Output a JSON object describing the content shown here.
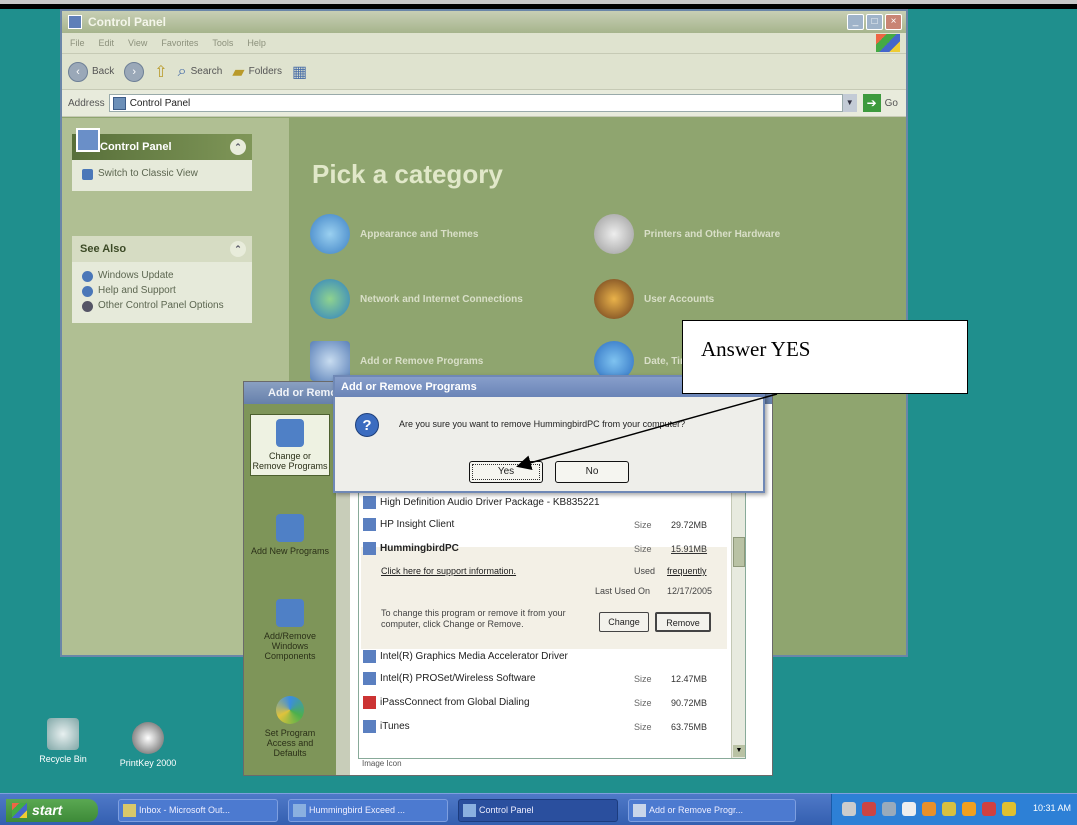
{
  "cp": {
    "title": "Control Panel",
    "menu": [
      "File",
      "Edit",
      "View",
      "Favorites",
      "Tools",
      "Help"
    ],
    "back_label": "Back",
    "search_label": "Search",
    "folders_label": "Folders",
    "address_label": "Address",
    "address_value": "Control Panel",
    "go_label": "Go",
    "panel_title": "Control Panel",
    "switch_view": "Switch to Classic View",
    "see_also_title": "See Also",
    "see_also": [
      "Windows Update",
      "Help and Support",
      "Other Control Panel Options"
    ],
    "pick_heading": "Pick a category",
    "categories": [
      "Appearance and Themes",
      "Printers and Other Hardware",
      "Network and Internet Connections",
      "User Accounts",
      "Add or Remove Programs",
      "Date, Time, Language, and Regional Options"
    ]
  },
  "arp": {
    "title": "Add or Remove Programs",
    "side": [
      "Change or Remove Programs",
      "Add New Programs",
      "Add/Remove Windows Components",
      "Set Program Access and Defaults"
    ],
    "programs": [
      {
        "name": "High Definition Audio Driver Package - KB835221",
        "size": ""
      },
      {
        "name": "HP Insight Client",
        "size": "29.72MB"
      },
      {
        "name": "HummingbirdPC",
        "size": "15.91MB"
      },
      {
        "name": "Intel(R) Graphics Media Accelerator Driver",
        "size": ""
      },
      {
        "name": "Intel(R) PROSet/Wireless Software",
        "size": "12.47MB"
      },
      {
        "name": "iPassConnect from Global Dialing",
        "size": "90.72MB"
      },
      {
        "name": "iTunes",
        "size": "63.75MB"
      }
    ],
    "size_label": "Size",
    "support_link": "Click here for support information.",
    "used_label": "Used",
    "used_value": "frequently",
    "last_used_label": "Last Used On",
    "last_used_value": "12/17/2005",
    "change_text": "To change this program or remove it from your computer, click Change or Remove.",
    "change_btn": "Change",
    "remove_btn": "Remove",
    "footer": "Image Icon"
  },
  "dialog": {
    "title": "Add or Remove Programs",
    "message": "Are you sure you want to remove HummingbirdPC from your computer?",
    "yes": "Yes",
    "no": "No"
  },
  "callout": {
    "text": "Answer YES"
  },
  "desktop": {
    "recycle": "Recycle Bin",
    "printkey": "PrintKey 2000"
  },
  "taskbar": {
    "start": "start",
    "tasks": [
      "Inbox - Microsoft Out...",
      "Hummingbird Exceed ...",
      "Control Panel",
      "Add or Remove Progr..."
    ],
    "clock": "10:31 AM"
  },
  "colors": {
    "desktop": "#1f8f8d",
    "cp_body": "#8fa56f",
    "taskbar": "#345fb0"
  }
}
